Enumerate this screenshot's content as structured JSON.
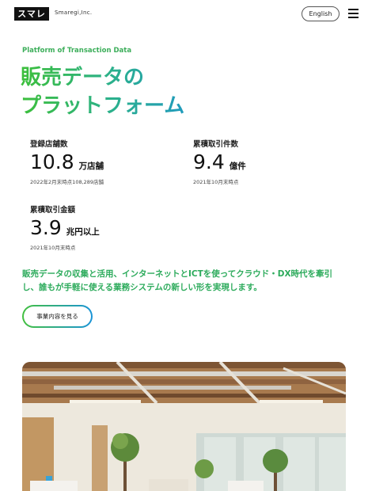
{
  "header": {
    "logo_text": "スマレジ",
    "company_name": "Smaregi,Inc.",
    "lang_button": "English",
    "menu_icon": "hamburger-icon"
  },
  "hero": {
    "eyebrow": "Platform of Transaction Data",
    "title_line1": "販売データの",
    "title_line2": "プラットフォーム"
  },
  "stats": [
    {
      "label": "登録店舗数",
      "value": "10.8",
      "unit": "万店舗",
      "note": "2022年2月末時点108,289店舗"
    },
    {
      "label": "累積取引件数",
      "value": "9.4",
      "unit": "億件",
      "note": "2021年10月末時点"
    },
    {
      "label": "累積取引金額",
      "value": "3.9",
      "unit": "兆円以上",
      "note": "2021年10月末時点"
    }
  ],
  "description": "販売データの収集と活用、インターネットとICTを使ってクラウド・DX時代を牽引し、誰もが手軽に使える業務システムの新しい形を実現します。",
  "cta": {
    "label": "事業内容を見る"
  },
  "colors": {
    "accent_green": "#3cae5a",
    "accent_blue": "#1a8ed8"
  }
}
